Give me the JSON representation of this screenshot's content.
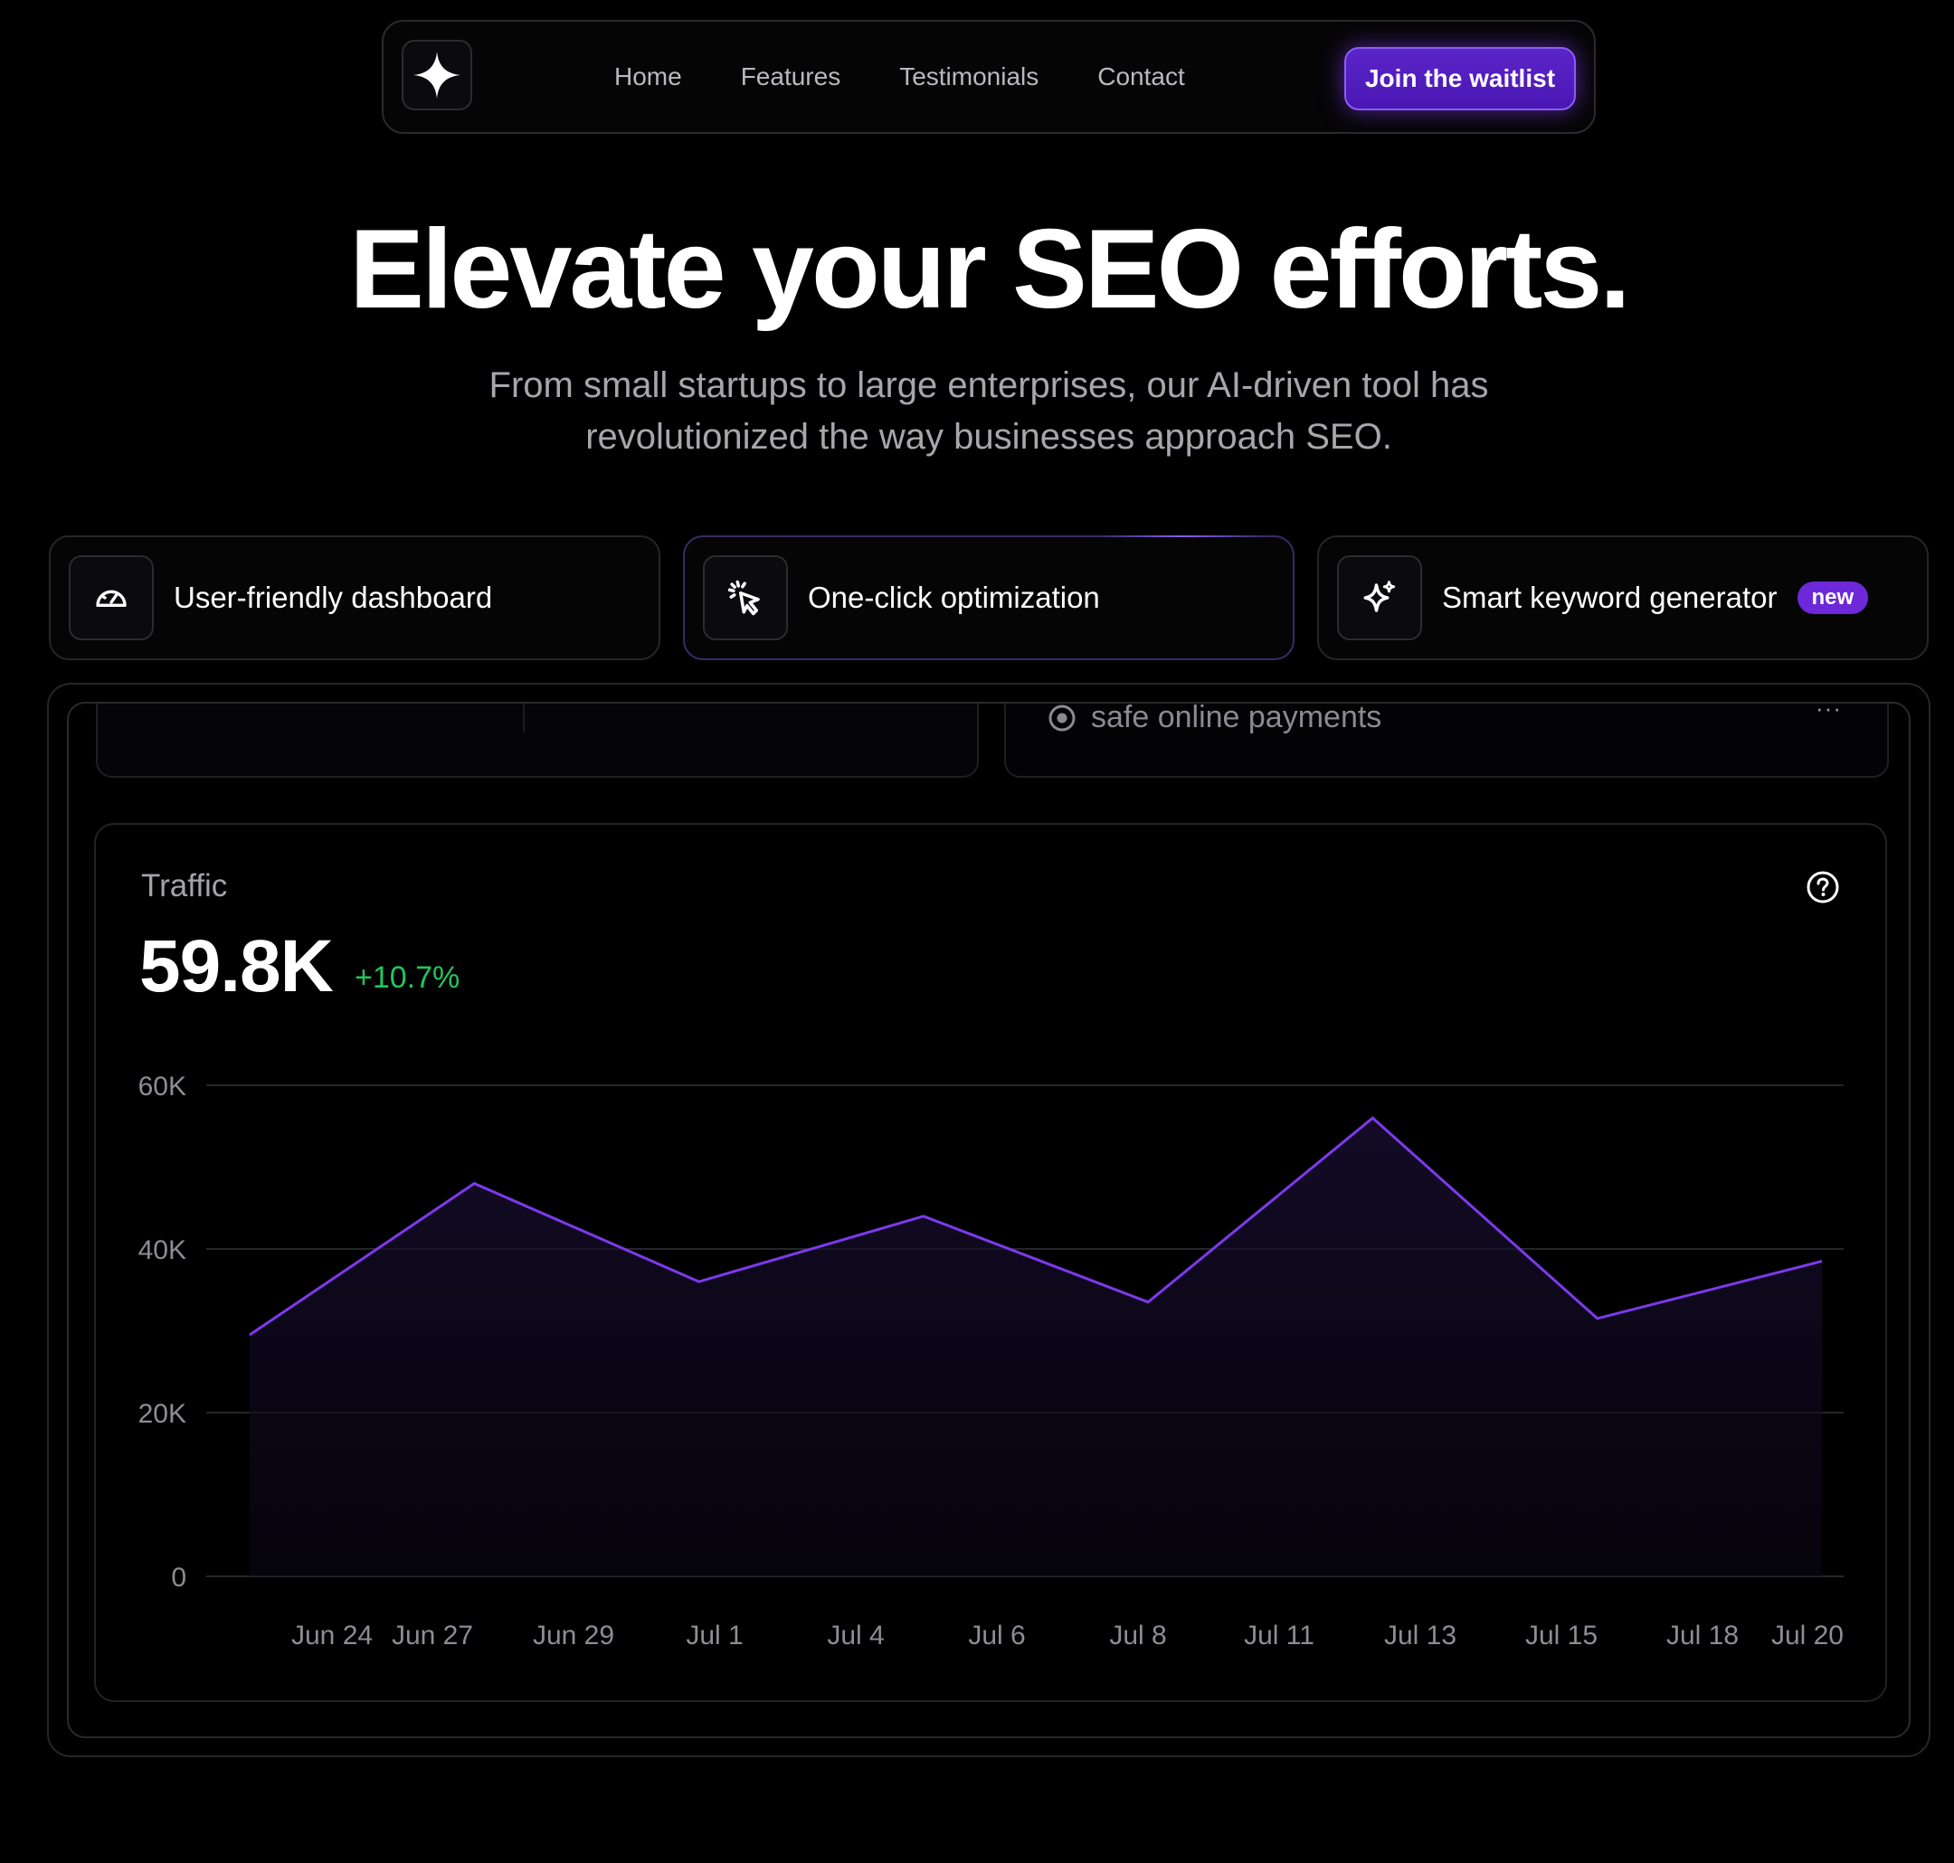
{
  "nav": {
    "links": [
      "Home",
      "Features",
      "Testimonials",
      "Contact"
    ],
    "cta_label": "Join the waitlist"
  },
  "hero": {
    "title": "Elevate your SEO efforts.",
    "subtitle": "From small startups to large enterprises, our AI-driven tool has revolutionized the way businesses approach SEO."
  },
  "features": [
    {
      "label": "User-friendly dashboard",
      "icon": "gauge-icon"
    },
    {
      "label": "One-click optimization",
      "icon": "cursor-click-icon"
    },
    {
      "label": "Smart keyword generator",
      "icon": "sparkles-icon",
      "badge": "new"
    }
  ],
  "dashboard": {
    "payments_label": "safe online payments",
    "more_label": "···",
    "traffic": {
      "label": "Traffic",
      "value": "59.8K",
      "change": "+10.7%"
    }
  },
  "colors": {
    "accent": "#7c3aed",
    "positive": "#22c55e",
    "background": "#000000"
  },
  "chart_data": {
    "type": "area",
    "title": "Traffic",
    "x": [
      "Jun 24",
      "Jun 27",
      "Jun 29",
      "Jul 1",
      "Jul 4",
      "Jul 6",
      "Jul 8",
      "Jul 11",
      "Jul 13",
      "Jul 15",
      "Jul 18",
      "Jul 20"
    ],
    "series": [
      {
        "values": [
          29500,
          null,
          48000,
          null,
          36000,
          null,
          44000,
          null,
          33500,
          null,
          56000,
          null,
          31500,
          38500
        ]
      }
    ],
    "points": [
      {
        "x": "Jun 24",
        "y": 29500
      },
      {
        "x": "Jun 29",
        "y": 48000
      },
      {
        "x": "Jul 4",
        "y": 36000
      },
      {
        "x": "Jul 8",
        "y": 44000
      },
      {
        "x": "Jul 13",
        "y": 33500
      },
      {
        "x": "Jul 18",
        "y": 56000
      },
      {
        "x": "Jul 20",
        "y": 31500
      },
      {
        "x": "Jul 20",
        "y": 38500
      }
    ],
    "y_ticks": [
      "60K",
      "40K",
      "20K",
      "0"
    ],
    "y_tick_values": [
      60000,
      40000,
      20000,
      0
    ],
    "ylim": [
      0,
      60000
    ],
    "grid": true
  }
}
